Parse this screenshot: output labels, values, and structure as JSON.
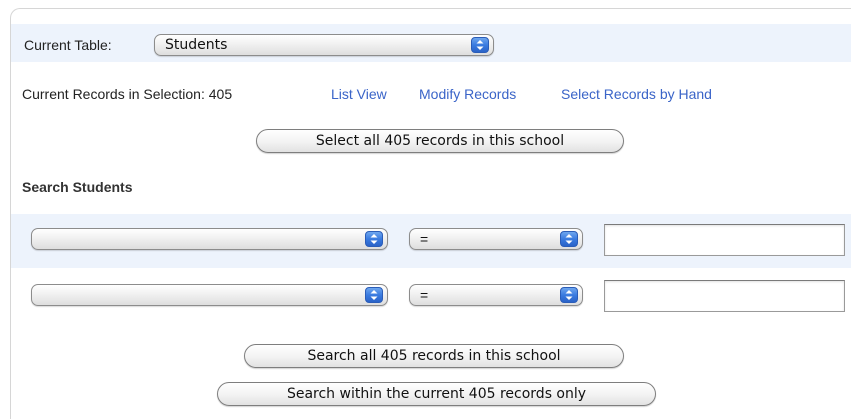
{
  "current_table": {
    "label": "Current Table:",
    "selected": "Students"
  },
  "selection_info": {
    "label": "Current Records in Selection: 405",
    "links": {
      "list_view": "List View",
      "modify_records": "Modify Records",
      "select_by_hand": "Select Records by Hand"
    }
  },
  "select_all_button": "Select all 405 records in this school",
  "search_section": {
    "heading": "Search Students",
    "rows": [
      {
        "field": "",
        "operator": "=",
        "value": ""
      },
      {
        "field": "",
        "operator": "=",
        "value": ""
      }
    ]
  },
  "search_buttons": {
    "search_all": "Search all 405 records in this school",
    "search_within": "Search within the current 405 records only"
  },
  "colors": {
    "row_highlight": "#edf3fc",
    "link": "#3a64c8",
    "popup_arrow": "#3a7be0"
  },
  "icons": {
    "popup_arrow": "updown-chevron-icon"
  }
}
